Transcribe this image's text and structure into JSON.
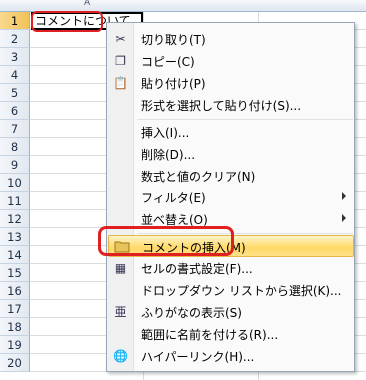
{
  "sheet": {
    "column_letter": "A",
    "rows": [
      "1",
      "2",
      "3",
      "4",
      "5",
      "6",
      "7",
      "8",
      "9",
      "10",
      "11",
      "12",
      "13",
      "14",
      "15",
      "16",
      "17",
      "18",
      "19",
      "20"
    ],
    "cell_a1": "コメントについて"
  },
  "menu": {
    "items": [
      {
        "label": "切り取り(T)",
        "icon": "scissors-icon"
      },
      {
        "label": "コピー(C)",
        "icon": "copy-icon"
      },
      {
        "label": "貼り付け(P)",
        "icon": "paste-icon"
      },
      {
        "label": "形式を選択して貼り付け(S)...",
        "icon": ""
      },
      {
        "label": "挿入(I)...",
        "icon": ""
      },
      {
        "label": "削除(D)...",
        "icon": ""
      },
      {
        "label": "数式と値のクリア(N)",
        "icon": ""
      },
      {
        "label": "フィルタ(E)",
        "icon": "",
        "submenu": true
      },
      {
        "label": "並べ替え(O)",
        "icon": "",
        "submenu": true
      },
      {
        "label": "コメントの挿入(M)",
        "icon": "comment-icon",
        "highlighted": true
      },
      {
        "label": "セルの書式設定(F)...",
        "icon": "format-cells-icon"
      },
      {
        "label": "ドロップダウン リストから選択(K)...",
        "icon": ""
      },
      {
        "label": "ふりがなの表示(S)",
        "icon": "furigana-icon"
      },
      {
        "label": "範囲に名前を付ける(R)...",
        "icon": ""
      },
      {
        "label": "ハイパーリンク(H)...",
        "icon": "hyperlink-icon"
      }
    ]
  },
  "colors": {
    "highlight": "#ffd966",
    "annotation_red": "#e02020"
  }
}
